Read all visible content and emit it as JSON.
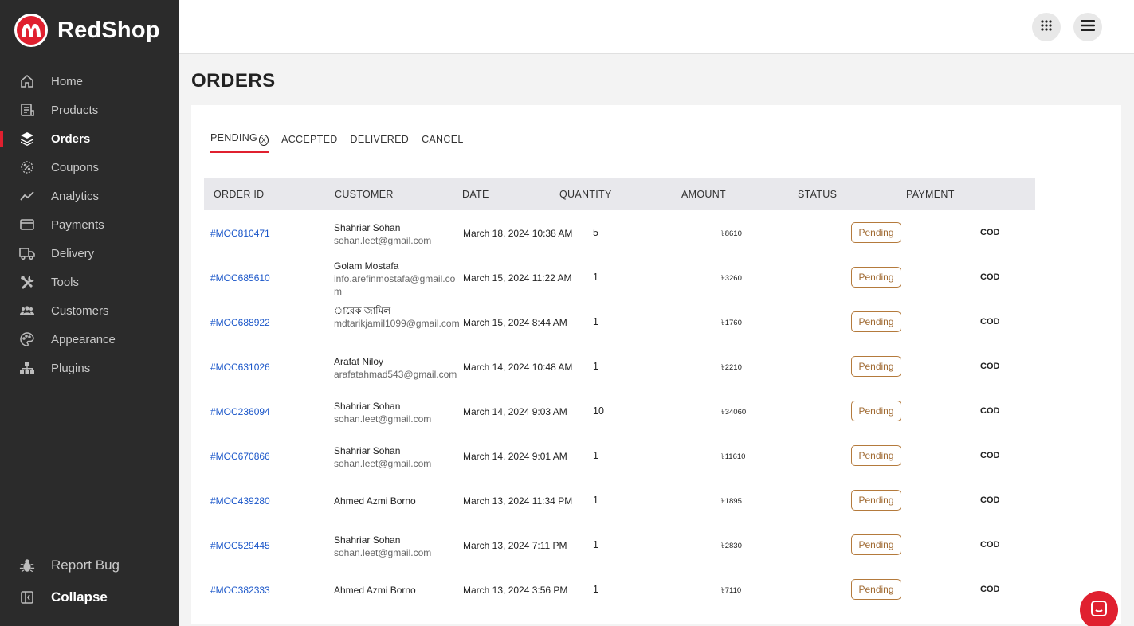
{
  "brand": {
    "name": "RedShop",
    "accent": "#e0202f"
  },
  "sidebar": {
    "items": [
      {
        "label": "Home",
        "icon": "home-icon"
      },
      {
        "label": "Products",
        "icon": "products-icon"
      },
      {
        "label": "Orders",
        "icon": "layers-icon",
        "active": true
      },
      {
        "label": "Coupons",
        "icon": "coupon-icon"
      },
      {
        "label": "Analytics",
        "icon": "analytics-icon"
      },
      {
        "label": "Payments",
        "icon": "card-icon"
      },
      {
        "label": "Delivery",
        "icon": "truck-icon"
      },
      {
        "label": "Tools",
        "icon": "tools-icon"
      },
      {
        "label": "Customers",
        "icon": "users-icon"
      },
      {
        "label": "Appearance",
        "icon": "palette-icon"
      },
      {
        "label": "Plugins",
        "icon": "plugins-icon"
      }
    ],
    "report_bug": "Report Bug",
    "collapse": "Collapse"
  },
  "page": {
    "title": "ORDERS"
  },
  "tabs": [
    {
      "label": "PENDING",
      "active": true
    },
    {
      "label": "ACCEPTED"
    },
    {
      "label": "DELIVERED"
    },
    {
      "label": "CANCEL"
    }
  ],
  "tab_close_glyph": "X",
  "table": {
    "columns": [
      "ORDER ID",
      "CUSTOMER",
      "DATE",
      "QUANTITY",
      "AMOUNT",
      "STATUS",
      "PAYMENT"
    ],
    "rows": [
      {
        "id": "#MOC810471",
        "name": "Shahriar Sohan",
        "email": "sohan.leet@gmail.com",
        "date": "March 18, 2024 10:38 AM",
        "qty": "5",
        "amount": "৳8610",
        "status": "Pending",
        "payment": "COD"
      },
      {
        "id": "#MOC685610",
        "name": "Golam Mostafa",
        "email": "info.arefinmostafa@gmail.com",
        "date": "March 15, 2024 11:22 AM",
        "qty": "1",
        "amount": "৳3260",
        "status": "Pending",
        "payment": "COD"
      },
      {
        "id": "#MOC688922",
        "name": "ারেক জামিল",
        "email": "mdtarikjamil1099@gmail.com",
        "date": "March 15, 2024 8:44 AM",
        "qty": "1",
        "amount": "৳1760",
        "status": "Pending",
        "payment": "COD"
      },
      {
        "id": "#MOC631026",
        "name": "Arafat Niloy",
        "email": "arafatahmad543@gmail.com",
        "date": "March 14, 2024 10:48 AM",
        "qty": "1",
        "amount": "৳2210",
        "status": "Pending",
        "payment": "COD"
      },
      {
        "id": "#MOC236094",
        "name": "Shahriar Sohan",
        "email": "sohan.leet@gmail.com",
        "date": "March 14, 2024 9:03 AM",
        "qty": "10",
        "amount": "৳34060",
        "status": "Pending",
        "payment": "COD"
      },
      {
        "id": "#MOC670866",
        "name": "Shahriar Sohan",
        "email": "sohan.leet@gmail.com",
        "date": "March 14, 2024 9:01 AM",
        "qty": "1",
        "amount": "৳11610",
        "status": "Pending",
        "payment": "COD"
      },
      {
        "id": "#MOC439280",
        "name": "Ahmed Azmi Borno",
        "email": "",
        "date": "March 13, 2024 11:34 PM",
        "qty": "1",
        "amount": "৳1895",
        "status": "Pending",
        "payment": "COD"
      },
      {
        "id": "#MOC529445",
        "name": "Shahriar Sohan",
        "email": "sohan.leet@gmail.com",
        "date": "March 13, 2024 7:11 PM",
        "qty": "1",
        "amount": "৳2830",
        "status": "Pending",
        "payment": "COD"
      },
      {
        "id": "#MOC382333",
        "name": "Ahmed Azmi Borno",
        "email": "",
        "date": "March 13, 2024 3:56 PM",
        "qty": "1",
        "amount": "৳7110",
        "status": "Pending",
        "payment": "COD"
      }
    ]
  }
}
